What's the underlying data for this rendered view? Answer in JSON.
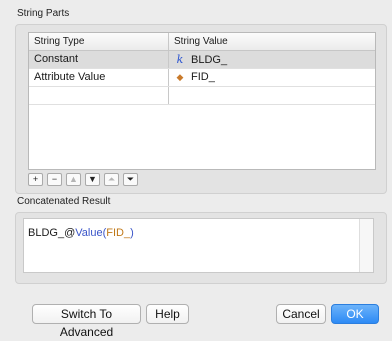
{
  "string_parts": {
    "title": "String Parts",
    "columns": [
      "String Type",
      "String Value"
    ],
    "rows": [
      {
        "type": "Constant",
        "value": "BLDG_",
        "icon": "constant-k-icon"
      },
      {
        "type": "Attribute Value",
        "value": "FID_",
        "icon": "attribute-tag-icon"
      },
      {
        "type": "",
        "value": "",
        "icon": ""
      }
    ],
    "selected_row": 0,
    "toolbar": {
      "add": "+",
      "remove": "−",
      "move_up": "▲",
      "move_down": "▼",
      "move_top": "⏶",
      "move_bottom": "⏷"
    }
  },
  "concatenated": {
    "title": "Concatenated Result",
    "prefix": "BLDG_@",
    "function": "Value",
    "open": "(",
    "argument": "FID_",
    "close": ")"
  },
  "buttons": {
    "switch": "Switch To Advanced",
    "help": "Help",
    "cancel": "Cancel",
    "ok": "OK"
  },
  "colors": {
    "accent": "#2d8af5",
    "function": "#3a55c9",
    "argument": "#c07818"
  }
}
